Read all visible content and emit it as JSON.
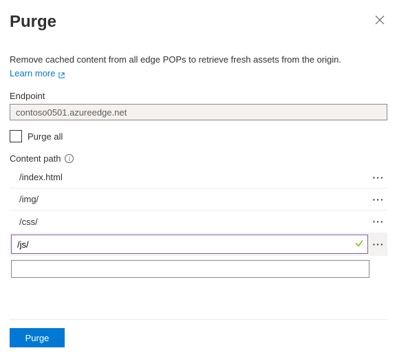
{
  "header": {
    "title": "Purge"
  },
  "intro": {
    "text": "Remove cached content from all edge POPs to retrieve fresh assets from the origin.",
    "learn_more": "Learn more"
  },
  "endpoint": {
    "label": "Endpoint",
    "value": "contoso0501.azureedge.net"
  },
  "purge_all": {
    "label": "Purge all",
    "checked": false
  },
  "content_path": {
    "label": "Content path",
    "rows": [
      {
        "value": "/index.html"
      },
      {
        "value": "/img/"
      },
      {
        "value": "/css/"
      }
    ],
    "active": {
      "value": "/js/"
    },
    "empty": {
      "value": ""
    }
  },
  "footer": {
    "purge_button": "Purge"
  }
}
